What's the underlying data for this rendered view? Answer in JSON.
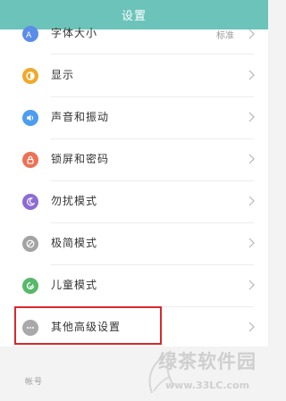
{
  "header": {
    "title": "设置"
  },
  "rows": [
    {
      "label": "字体大小",
      "value": "标准",
      "icon": "font-icon",
      "color": "#5a8de8"
    },
    {
      "label": "显示",
      "icon": "display-icon",
      "color": "#f0a92c"
    },
    {
      "label": "声音和振动",
      "icon": "speaker-icon",
      "color": "#4c9cf0"
    },
    {
      "label": "锁屏和密码",
      "icon": "lock-icon",
      "color": "#ec7155"
    },
    {
      "label": "勿扰模式",
      "icon": "moon-icon",
      "color": "#8c6cd3"
    },
    {
      "label": "极简模式",
      "icon": "minimal-icon",
      "color": "#a3a3a3"
    },
    {
      "label": "儿童模式",
      "icon": "child-icon",
      "color": "#58b86a"
    },
    {
      "label": "其他高级设置",
      "icon": "more-icon",
      "color": "#a9a9a9"
    }
  ],
  "section": {
    "label": "帐号"
  },
  "watermark": {
    "title": "绿茶软件园",
    "url": "www.33LC.com"
  },
  "colors": {
    "header": "#6cc3ba",
    "highlight": "#d9282b"
  }
}
